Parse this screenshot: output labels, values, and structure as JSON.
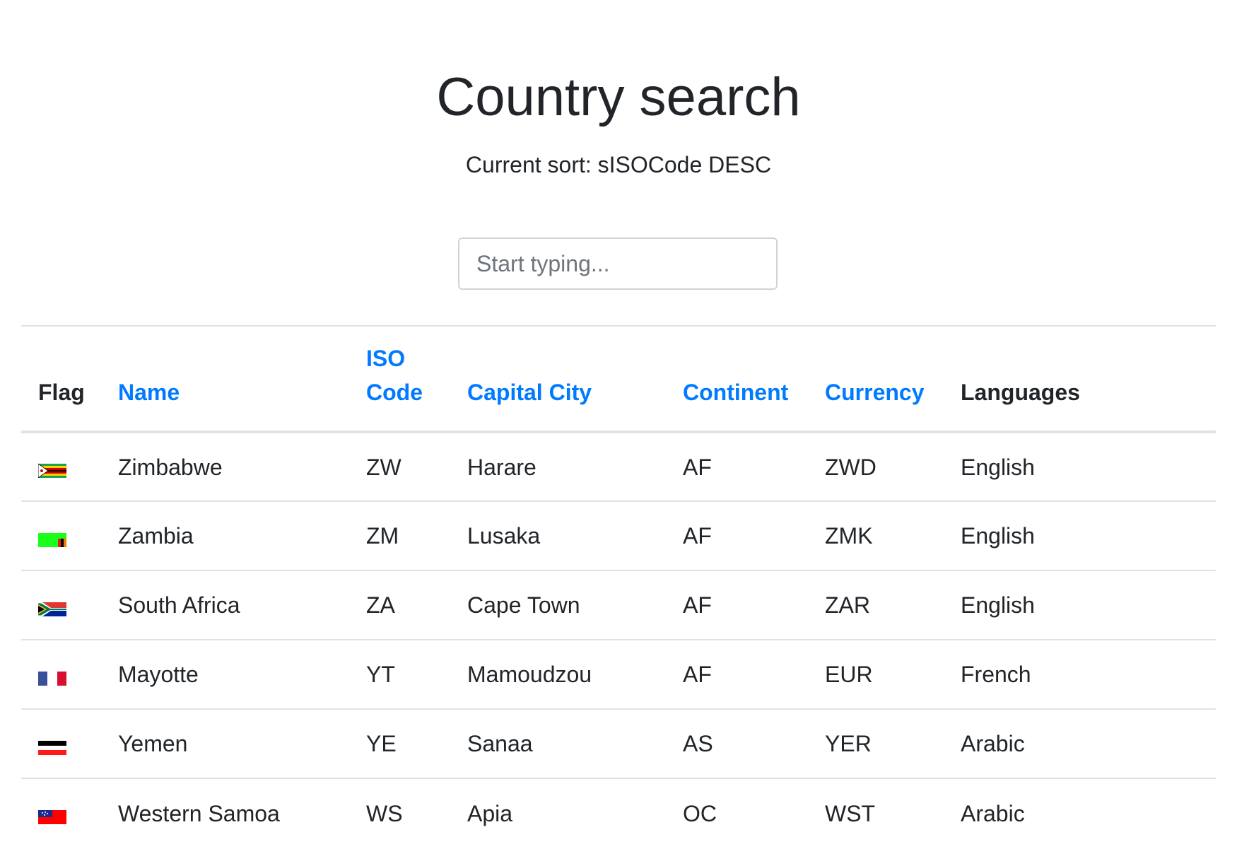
{
  "header": {
    "title": "Country search",
    "sort_status": "Current sort: sISOCode DESC"
  },
  "search": {
    "placeholder": "Start typing...",
    "value": ""
  },
  "table": {
    "columns": [
      {
        "label": "Flag",
        "sortable": false
      },
      {
        "label": "Name",
        "sortable": true
      },
      {
        "label": "ISO Code",
        "sortable": true
      },
      {
        "label": "Capital City",
        "sortable": true
      },
      {
        "label": "Continent",
        "sortable": true
      },
      {
        "label": "Currency",
        "sortable": true
      },
      {
        "label": "Languages",
        "sortable": false
      }
    ],
    "rows": [
      {
        "flag_icon": "zimbabwe-flag-icon",
        "name": "Zimbabwe",
        "iso": "ZW",
        "capital": "Harare",
        "continent": "AF",
        "currency": "ZWD",
        "languages": "English"
      },
      {
        "flag_icon": "zambia-flag-icon",
        "name": "Zambia",
        "iso": "ZM",
        "capital": "Lusaka",
        "continent": "AF",
        "currency": "ZMK",
        "languages": "English"
      },
      {
        "flag_icon": "south-africa-flag-icon",
        "name": "South Africa",
        "iso": "ZA",
        "capital": "Cape Town",
        "continent": "AF",
        "currency": "ZAR",
        "languages": "English"
      },
      {
        "flag_icon": "mayotte-flag-icon",
        "name": "Mayotte",
        "iso": "YT",
        "capital": "Mamoudzou",
        "continent": "AF",
        "currency": "EUR",
        "languages": "French"
      },
      {
        "flag_icon": "yemen-flag-icon",
        "name": "Yemen",
        "iso": "YE",
        "capital": "Sanaa",
        "continent": "AS",
        "currency": "YER",
        "languages": "Arabic"
      },
      {
        "flag_icon": "western-samoa-flag-icon",
        "name": "Western Samoa",
        "iso": "WS",
        "capital": "Apia",
        "continent": "OC",
        "currency": "WST",
        "languages": "Arabic"
      }
    ]
  },
  "colors": {
    "link": "#007bff",
    "text": "#212529",
    "border": "#dee2e6"
  }
}
